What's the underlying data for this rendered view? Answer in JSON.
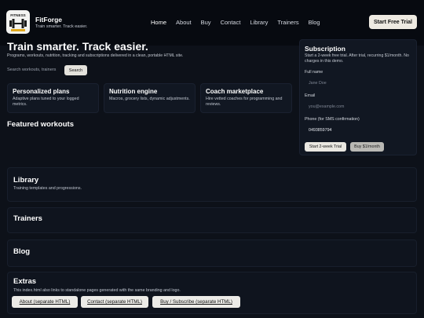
{
  "header": {
    "brand_name": "FitForge",
    "brand_tagline": "Train smarter. Track easier.",
    "logo_text": "FITNESS",
    "nav": [
      {
        "label": "Home"
      },
      {
        "label": "About"
      },
      {
        "label": "Buy"
      },
      {
        "label": "Contact"
      },
      {
        "label": "Library"
      },
      {
        "label": "Trainers"
      },
      {
        "label": "Blog"
      }
    ],
    "cta_label": "Start Free Trial"
  },
  "hero": {
    "title": "Train smarter. Track easier.",
    "subtitle": "Programs, workouts, nutrition, tracking and subscriptions delivered in a clean, portable HTML site.",
    "search_placeholder": "Search workouts, trainers",
    "search_button": "Search"
  },
  "features": [
    {
      "title": "Personalized plans",
      "desc": "Adaptive plans tuned to your logged metrics."
    },
    {
      "title": "Nutrition engine",
      "desc": "Macros, grocery lists, dynamic adjustments."
    },
    {
      "title": "Coach marketplace",
      "desc": "Hire vetted coaches for programming and reviews."
    }
  ],
  "featured_title": "Featured workouts",
  "subscription": {
    "title": "Subscription",
    "desc": "Start a 2-week free trial. After trial, recurring $1/month. No charges in this demo.",
    "full_name_label": "Full name",
    "full_name_placeholder": "Jane Doe",
    "email_label": "Email",
    "email_placeholder": "you@example.com",
    "phone_label": "Phone (for SMS confirmation)",
    "phone_value": "0493859794",
    "trial_button": "Start 2-week Trial",
    "buy_button": "Buy $1/month"
  },
  "sections": {
    "library_title": "Library",
    "library_desc": "Training templates and progressions.",
    "trainers_title": "Trainers",
    "blog_title": "Blog",
    "extras_title": "Extras",
    "extras_desc": "This index.html also links to standalone pages generated with the same branding and logo.",
    "extras_links": [
      {
        "label": "About (separate HTML)"
      },
      {
        "label": "Contact (separate HTML)"
      },
      {
        "label": "Buy / Subscribe (separate HTML)"
      }
    ]
  },
  "colors": {
    "background": "#0d1119",
    "header": "#070a10",
    "card": "#111722",
    "logo_gold": "#e0a81c"
  }
}
